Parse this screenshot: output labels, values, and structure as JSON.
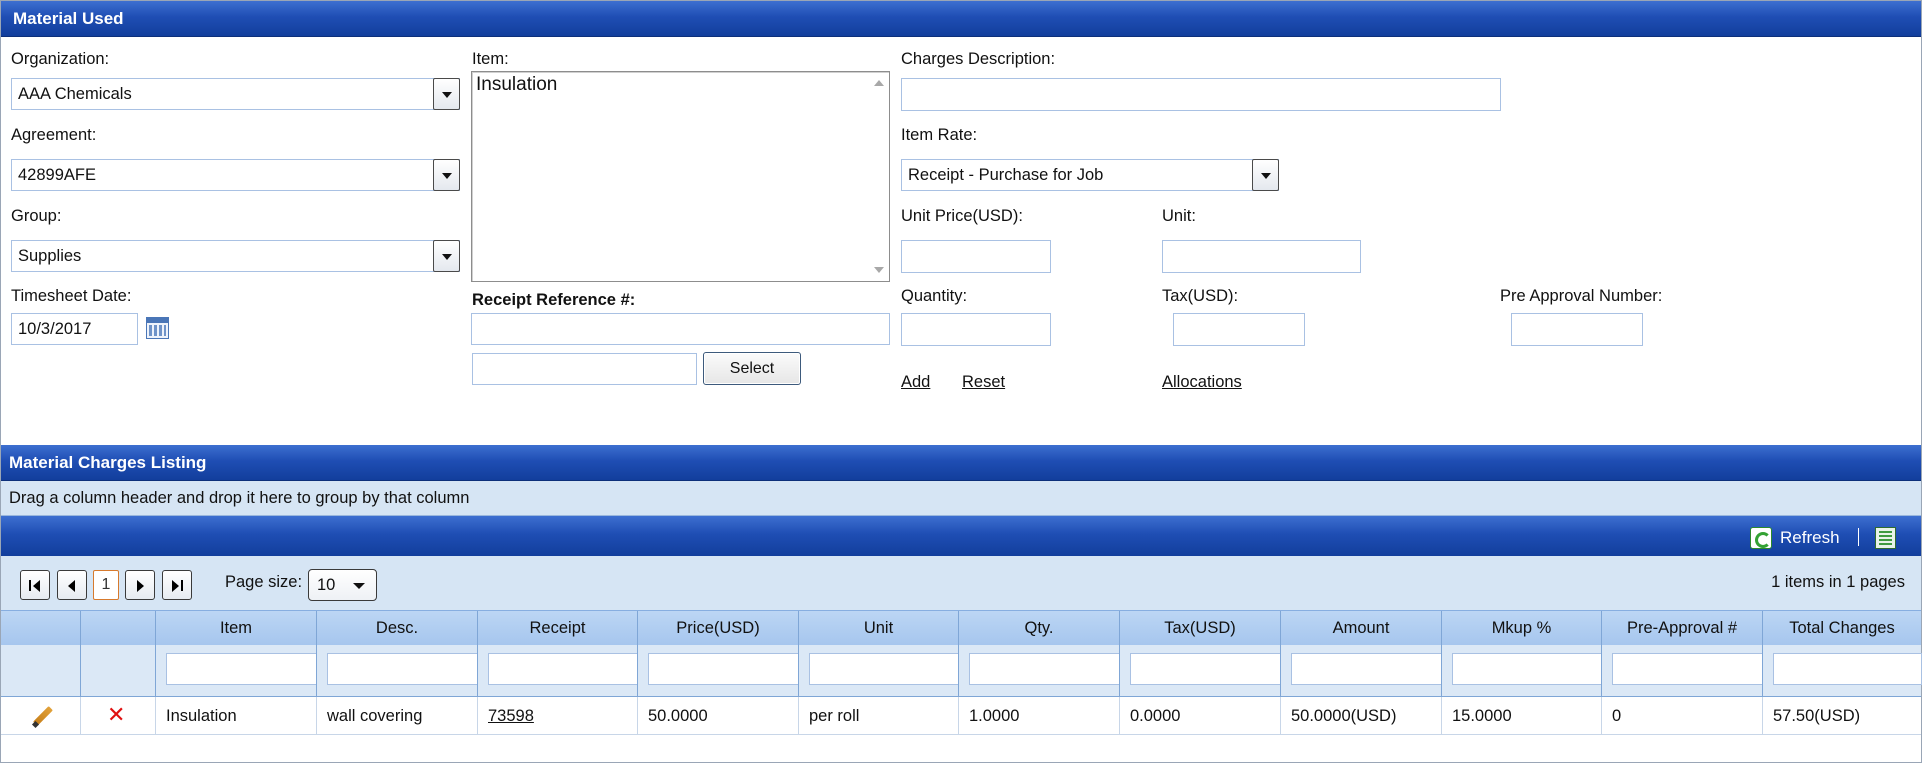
{
  "material_used": {
    "title": "Material Used",
    "organization": {
      "label": "Organization:",
      "value": "AAA Chemicals"
    },
    "agreement": {
      "label": "Agreement:",
      "value": "42899AFE"
    },
    "group": {
      "label": "Group:",
      "value": "Supplies"
    },
    "timesheet_date": {
      "label": "Timesheet Date:",
      "value": "10/3/2017"
    },
    "item": {
      "label": "Item:",
      "value": "Insulation"
    },
    "receipt_reference": {
      "label": "Receipt Reference #:",
      "value": "",
      "secondary_value": ""
    },
    "select_label": "Select",
    "charges_description": {
      "label": "Charges Description:",
      "value": ""
    },
    "item_rate": {
      "label": "Item Rate:",
      "value": "Receipt - Purchase for Job"
    },
    "unit_price": {
      "label": "Unit Price(USD):",
      "value": ""
    },
    "unit": {
      "label": "Unit:",
      "value": ""
    },
    "quantity": {
      "label": "Quantity:",
      "value": ""
    },
    "tax": {
      "label": "Tax(USD):",
      "value": ""
    },
    "pre_approval": {
      "label": "Pre Approval Number:",
      "value": ""
    },
    "links": {
      "add": "Add",
      "reset": "Reset",
      "allocations": "Allocations"
    }
  },
  "listing": {
    "title": "Material Charges Listing",
    "group_hint": "Drag a column header and drop it here to group by that column",
    "toolbar": {
      "refresh_label": "Refresh"
    },
    "pager": {
      "current_page": "1",
      "page_size_label": "Page size:",
      "page_size": "10",
      "info": "1 items in 1 pages"
    },
    "columns": [
      "Item",
      "Desc.",
      "Receipt",
      "Price(USD)",
      "Unit",
      "Qty.",
      "Tax(USD)",
      "Amount",
      "Mkup %",
      "Pre-Approval #",
      "Total Changes"
    ],
    "rows": [
      [
        "Insulation",
        "wall covering",
        "73598",
        "50.0000",
        "per roll",
        "1.0000",
        "0.0000",
        "50.0000(USD)",
        "15.0000",
        "0",
        "57.50(USD)"
      ]
    ]
  },
  "colors": {
    "header_blue": "#1f4eb4",
    "grid_light": "#d6e5f4",
    "delete_red": "#e01010"
  }
}
